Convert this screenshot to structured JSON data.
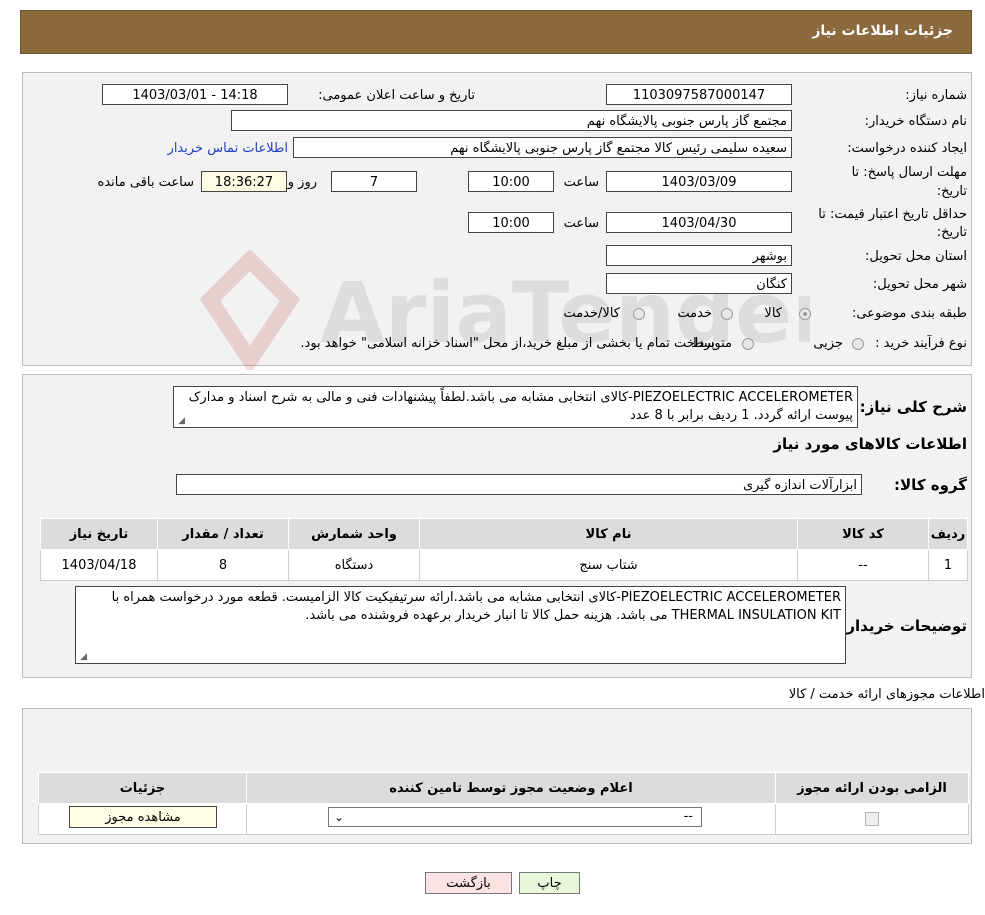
{
  "header": {
    "title": "جزئیات اطلاعات نیاز"
  },
  "watermark": {
    "text": "AriaTender.neT"
  },
  "info": {
    "need_number_label": "شماره نیاز:",
    "need_number": "1103097587000147",
    "announce_label": "تاریخ و ساعت اعلان عمومی:",
    "announce_value": "1403/03/01 - 14:18",
    "buyer_label": "نام دستگاه خریدار:",
    "buyer_value": "مجتمع گاز پارس جنوبی  پالایشگاه نهم",
    "creator_label": "ایجاد کننده درخواست:",
    "creator_value": "سعیده سلیمی رئیس کالا مجتمع گاز پارس جنوبی  پالایشگاه نهم",
    "contact_link": "اطلاعات تماس خریدار",
    "deadline_label": "مهلت ارسال پاسخ: تا",
    "deadline_label2": "تاریخ:",
    "deadline_date": "1403/03/09",
    "time_label": "ساعت",
    "deadline_time": "10:00",
    "days_value": "7",
    "days_label": "روز و",
    "remaining_time": "18:36:27",
    "remaining_label": "ساعت باقی مانده",
    "price_valid_label": "حداقل تاریخ اعتبار قیمت: تا",
    "price_valid_label2": "تاریخ:",
    "price_valid_date": "1403/04/30",
    "price_valid_time": "10:00",
    "province_label": "استان محل تحویل:",
    "province_value": "بوشهر",
    "city_label": "شهر محل تحویل:",
    "city_value": "کنگان",
    "category_label": "طبقه بندی موضوعی:",
    "category_options": [
      "کالا",
      "خدمت",
      "کالا/خدمت"
    ],
    "process_label": "نوع فرآیند خرید :",
    "process_options": [
      "جزیی",
      "متوسط"
    ],
    "process_note": "پرداخت تمام یا بخشی از مبلغ خرید،از محل \"اسناد خزانه اسلامی\" خواهد بود."
  },
  "description": {
    "label": "شرح کلی نیاز:",
    "text": "PIEZOELECTRIC ACCELEROMETER-کالای انتخابی مشابه می باشد.لطفاً پیشنهادات فنی و مالی به شرح اسناد و مدارک پیوست ارائه گردد. 1 ردیف برابر با 8 عدد"
  },
  "goods": {
    "section_title": "اطلاعات کالاهای مورد نیاز",
    "group_label": "گروه کالا:",
    "group_value": "ابزارآلات اندازه گیری",
    "columns": [
      "ردیف",
      "کد کالا",
      "نام کالا",
      "واحد شمارش",
      "تعداد / مقدار",
      "تاریخ نیاز"
    ],
    "rows": [
      {
        "row": "1",
        "code": "--",
        "name": "شتاب سنج",
        "unit": "دستگاه",
        "qty": "8",
        "date": "1403/04/18"
      }
    ],
    "buyer_notes_label": "توضیحات خریدار:",
    "buyer_notes": "PIEZOELECTRIC ACCELEROMETER-کالای انتخابی مشابه می باشد.ارائه سرتیفیکیت کالا الزامیست. قطعه مورد درخواست همراه با THERMAL INSULATION KIT می باشد. هزینه حمل کالا تا انبار خریدار برعهده فروشنده می باشد."
  },
  "permits": {
    "section_title": "اطلاعات مجوزهای ارائه خدمت / کالا",
    "columns": [
      "الزامی بودن ارائه مجوز",
      "اعلام وضعیت مجوز توسط تامین کننده",
      "جزئیات"
    ],
    "select_value": "--",
    "view_button": "مشاهده مجوز"
  },
  "buttons": {
    "print": "چاپ",
    "back": "بازگشت"
  }
}
